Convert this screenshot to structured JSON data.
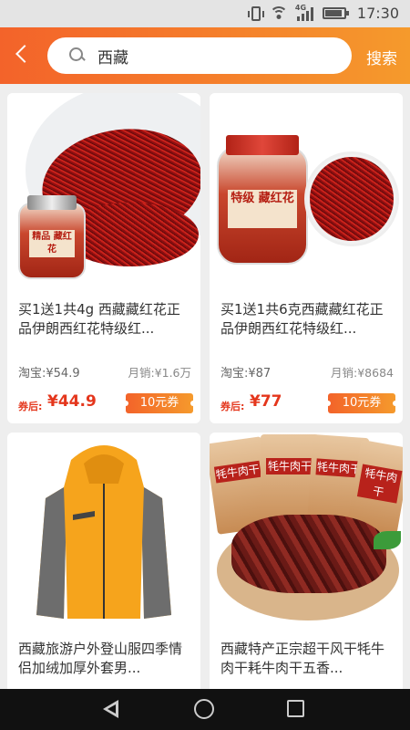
{
  "status_bar": {
    "network": "4G",
    "time": "17:30"
  },
  "header": {
    "search_value": "西藏",
    "search_button": "搜索"
  },
  "products": [
    {
      "title": "买1送1共4g 西藏藏红花正品伊朗西红花特级红...",
      "taobao_price": "淘宝:¥54.9",
      "monthly_sales": "月销:¥1.6万",
      "after_coupon_label": "券后:",
      "final_price": "¥44.9",
      "coupon": "10元券",
      "jar_label": "精品 藏红花"
    },
    {
      "title": "买1送1共6克西藏藏红花正品伊朗西红花特级红...",
      "taobao_price": "淘宝:¥87",
      "monthly_sales": "月销:¥8684",
      "after_coupon_label": "券后:",
      "final_price": "¥77",
      "coupon": "10元券",
      "jar_label": "特级 藏红花"
    },
    {
      "title": "西藏旅游户外登山服四季情侣加绒加厚外套男..."
    },
    {
      "title": "西藏特产正宗超干风干牦牛肉干耗牛肉干五香...",
      "bag_label": "牦牛肉干"
    }
  ],
  "colors": {
    "accent_start": "#f3632a",
    "accent_end": "#f59a2c",
    "price_red": "#e4361c"
  }
}
